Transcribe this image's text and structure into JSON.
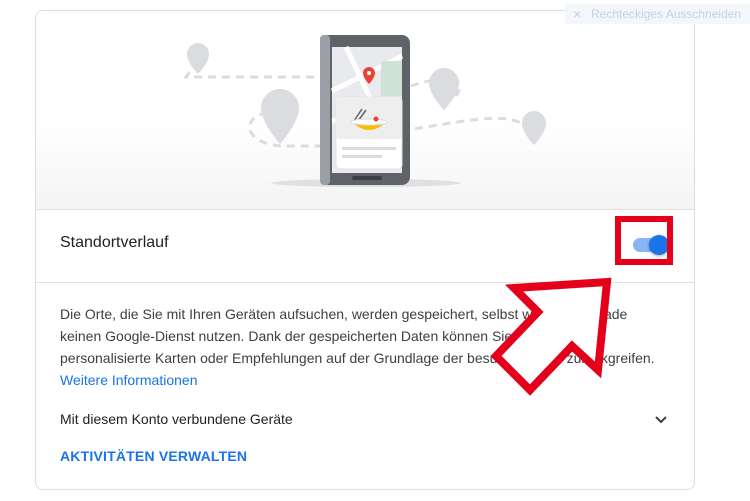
{
  "tooltip": {
    "label": "Rechteckiges Ausschneiden",
    "icon": "close-icon"
  },
  "location_history": {
    "title": "Standortverlauf",
    "toggle_state": "on",
    "description_prefix": "Die Orte, die Sie mit Ihren Geräten aufsuchen, werden gespeichert, selbst wenn Sie gerade keinen Google-Dienst nutzen. Dank der gespeicherten Daten können Sie dann etwa auf personalisierte Karten oder Empfehlungen auf der Grundlage der besuchten Orte zurückgreifen.",
    "more_info_link": "Weitere Informationen",
    "devices_label": "Mit diesem Konto verbundene Geräte",
    "manage_activity": "AKTIVITÄTEN VERWALTEN"
  },
  "colors": {
    "accent": "#1a73e8",
    "toggle_track": "#8ab4f8",
    "annotation_red": "#e4001b"
  }
}
